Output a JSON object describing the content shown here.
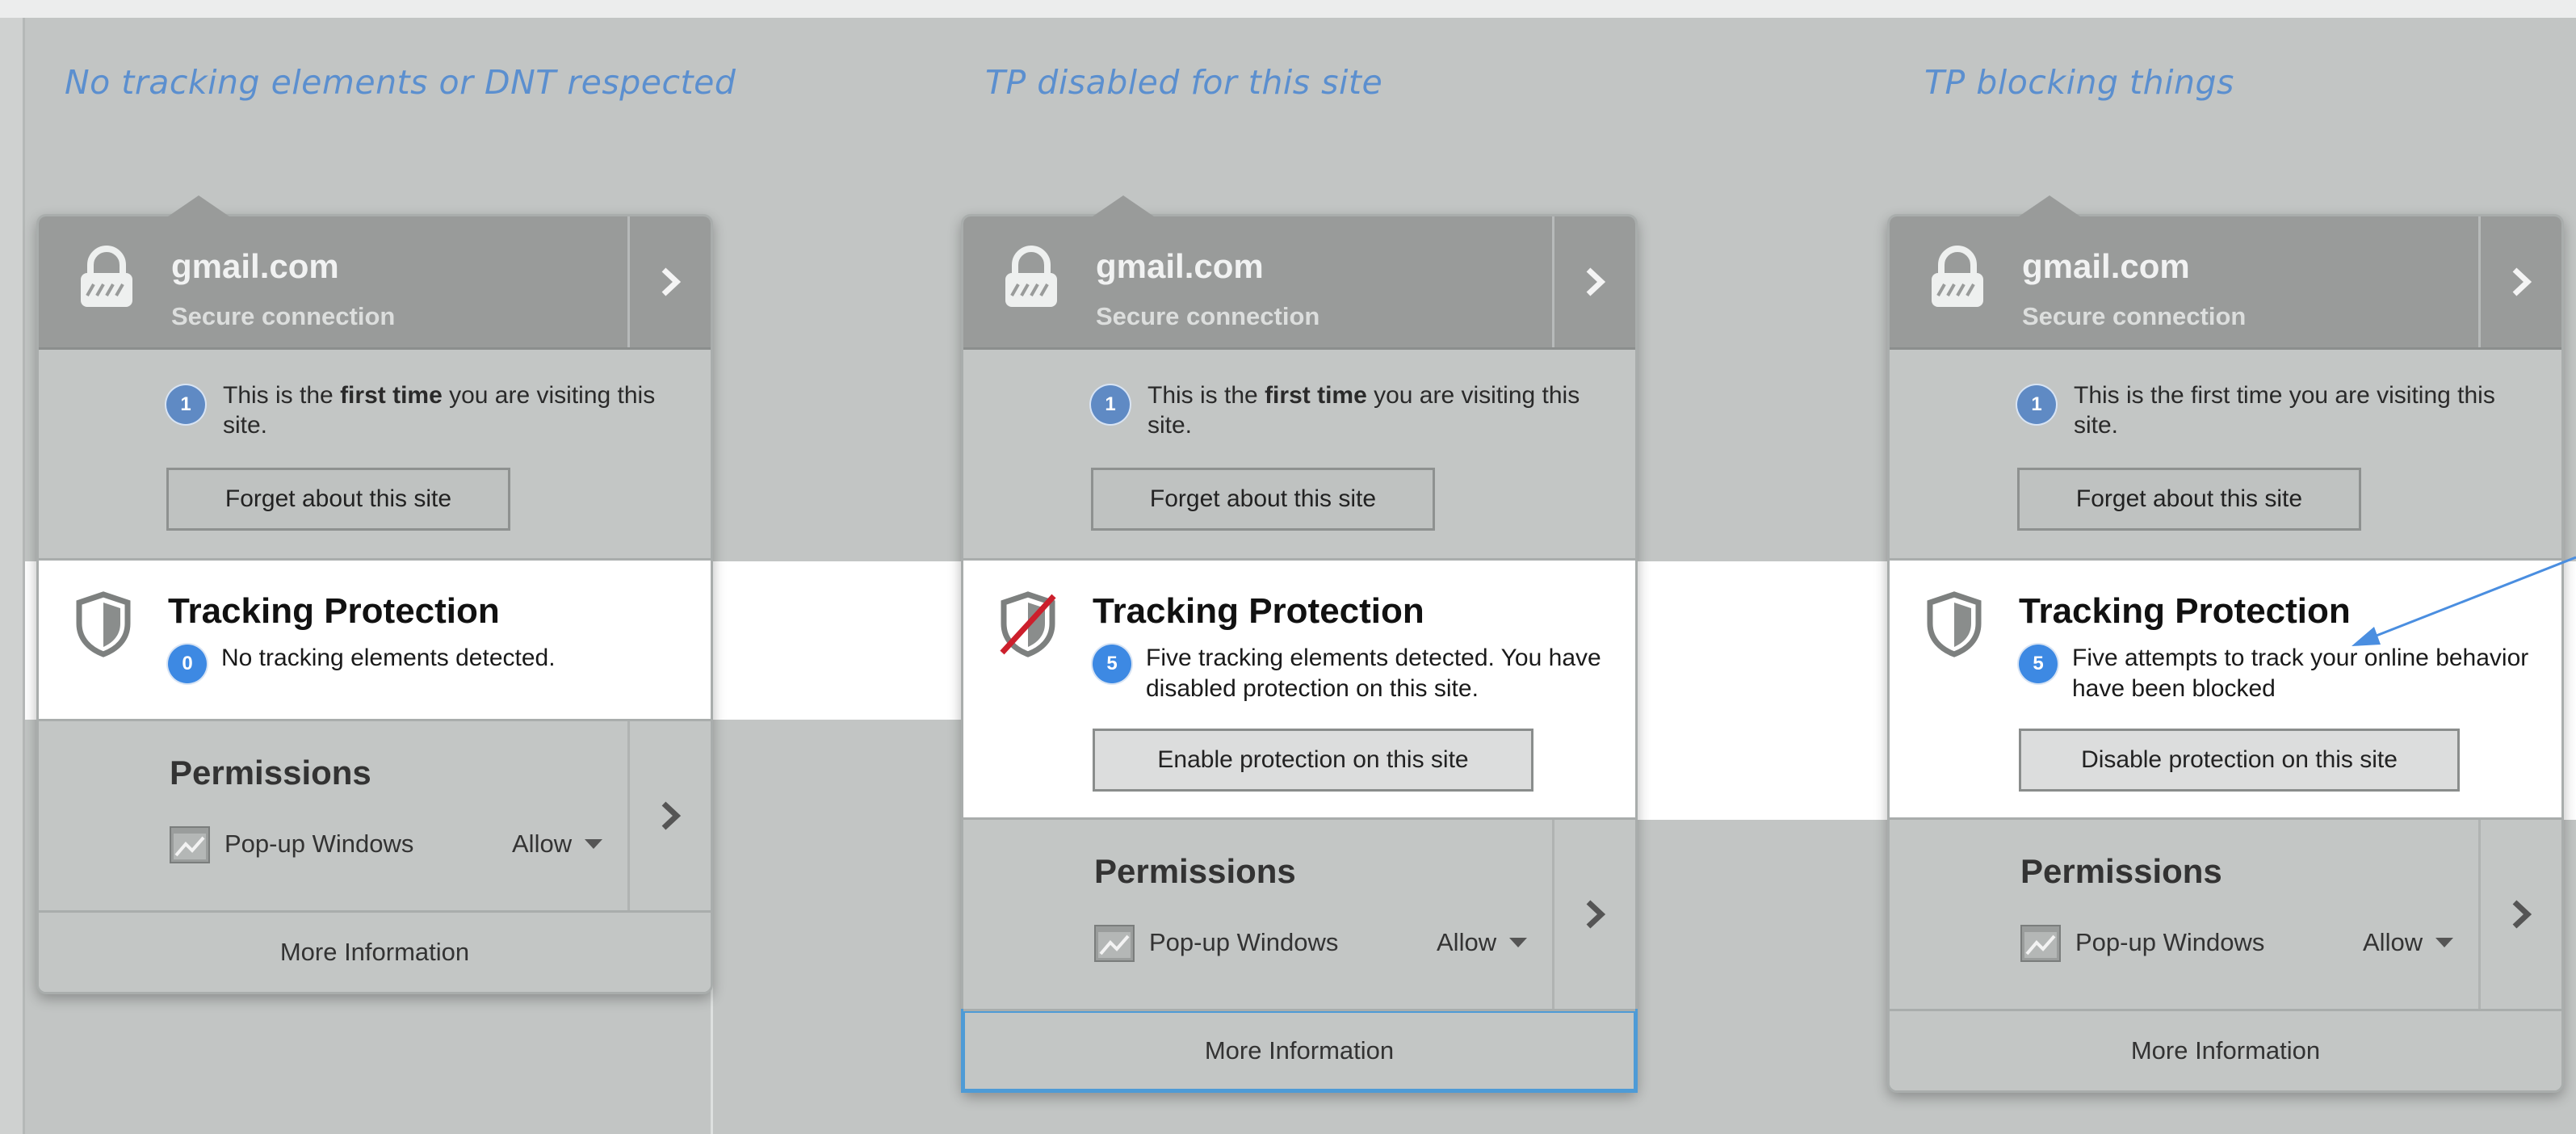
{
  "captions": {
    "col1": "No tracking elements or DNT respected",
    "col2": "TP disabled for this site",
    "col3": "TP blocking things"
  },
  "panels": [
    {
      "site": "gmail.com",
      "connection": "Secure connection",
      "visit_badge": "1",
      "visit_pre": "This is the ",
      "visit_bold": "first time",
      "visit_post": " you are visiting this site.",
      "forget_button": "Forget about this site",
      "tp_title": "Tracking Protection",
      "tp_badge": "0",
      "tp_text": "No tracking elements detected.",
      "permissions_title": "Permissions",
      "permission_item": "Pop-up Windows",
      "permission_value": "Allow",
      "more_info": "More Information"
    },
    {
      "site": "gmail.com",
      "connection": "Secure connection",
      "visit_badge": "1",
      "visit_pre": "This is the ",
      "visit_bold": "first time",
      "visit_post": " you are visiting this site.",
      "forget_button": "Forget about this site",
      "tp_title": "Tracking Protection",
      "tp_badge": "5",
      "tp_text": "Five tracking elements detected. You have disabled protection on this site.",
      "tp_button": "Enable protection on this site",
      "permissions_title": "Permissions",
      "permission_item": "Pop-up Windows",
      "permission_value": "Allow",
      "more_info": "More Information"
    },
    {
      "site": "gmail.com",
      "connection": "Secure connection",
      "visit_badge": "1",
      "visit_text": "This is the first time you are visiting this site.",
      "forget_button": "Forget about this site",
      "tp_title": "Tracking Protection",
      "tp_badge": "5",
      "tp_text": "Five attempts to track your online behavior have been blocked",
      "tp_button": "Disable protection on this site",
      "permissions_title": "Permissions",
      "permission_item": "Pop-up Windows",
      "permission_value": "Allow",
      "more_info": "More Information"
    }
  ],
  "colors": {
    "background": "#c2c5c4",
    "header": "#999b9a",
    "caption": "#5b8fcf",
    "badge_blue": "#3d89e3",
    "badge_steel": "#5f8ac4",
    "focus_ring": "#4e9bd6",
    "slash_red": "#cc1f2c"
  },
  "icons": [
    "lock-icon",
    "chevron-right-icon",
    "shield-icon",
    "shield-disabled-icon",
    "popup-window-icon",
    "caret-down-icon",
    "annotation-arrow"
  ]
}
